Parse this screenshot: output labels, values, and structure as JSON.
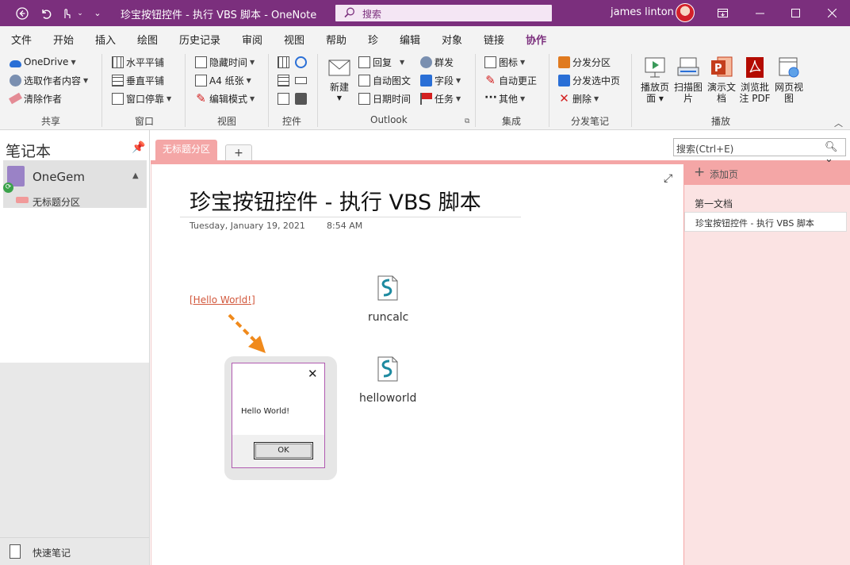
{
  "titlebar": {
    "title": "珍宝按钮控件 - 执行 VBS 脚本  -  OneNote",
    "search_placeholder": "搜索",
    "user": "james linton"
  },
  "tabs": [
    "文件",
    "开始",
    "插入",
    "绘图",
    "历史记录",
    "审阅",
    "视图",
    "帮助",
    "珍",
    "编辑",
    "对象",
    "链接",
    "协作"
  ],
  "active_tab": "协作",
  "ribbon": {
    "share": {
      "items": [
        "OneDrive",
        "选取作者内容",
        "清除作者"
      ],
      "label": "共享"
    },
    "window": {
      "items": [
        "水平平铺",
        "垂直平铺",
        "窗口停靠"
      ],
      "label": "窗口"
    },
    "view": {
      "items": [
        "隐藏时间",
        "A4 纸张",
        "编辑模式"
      ],
      "label": "视图"
    },
    "controls": {
      "label": "控件"
    },
    "outlook": {
      "new": "新建",
      "items": [
        "回复",
        "自动图文",
        "日期时间",
        "群发",
        "字段",
        "任务"
      ],
      "label": "Outlook"
    },
    "integrate": {
      "items": [
        "图标",
        "自动更正",
        "其他"
      ],
      "label": "集成"
    },
    "distribute": {
      "items": [
        "分发分区",
        "分发选中页",
        "删除"
      ],
      "label": "分发笔记"
    },
    "play": {
      "items": [
        "播放页面",
        "扫描图片",
        "演示文档",
        "浏览批注 PDF",
        "网页视图"
      ],
      "label": "播放"
    }
  },
  "notebook": {
    "heading": "笔记本",
    "name": "OneGem",
    "section": "无标题分区",
    "quick_notes": "快速笔记"
  },
  "section_tab": "无标题分区",
  "search_box": {
    "placeholder": "搜索(Ctrl+E)"
  },
  "page": {
    "title": "珍宝按钮控件 - 执行 VBS 脚本",
    "date": "Tuesday, January 19, 2021",
    "time": "8:54 AM",
    "link": "[Hello World!]",
    "files": [
      "runcalc",
      "helloworld"
    ]
  },
  "dialog": {
    "message": "Hello World!",
    "ok": "OK"
  },
  "pagelist": {
    "add_page": "添加页",
    "pages": [
      "第一文档",
      "珍宝按钮控件 - 执行 VBS 脚本"
    ]
  },
  "colors": {
    "brand": "#7b2f7d",
    "section": "#f4a6a6",
    "pagelist_bg": "#fbe3e3",
    "link": "#d2573b",
    "arrow": "#f08a1c"
  }
}
